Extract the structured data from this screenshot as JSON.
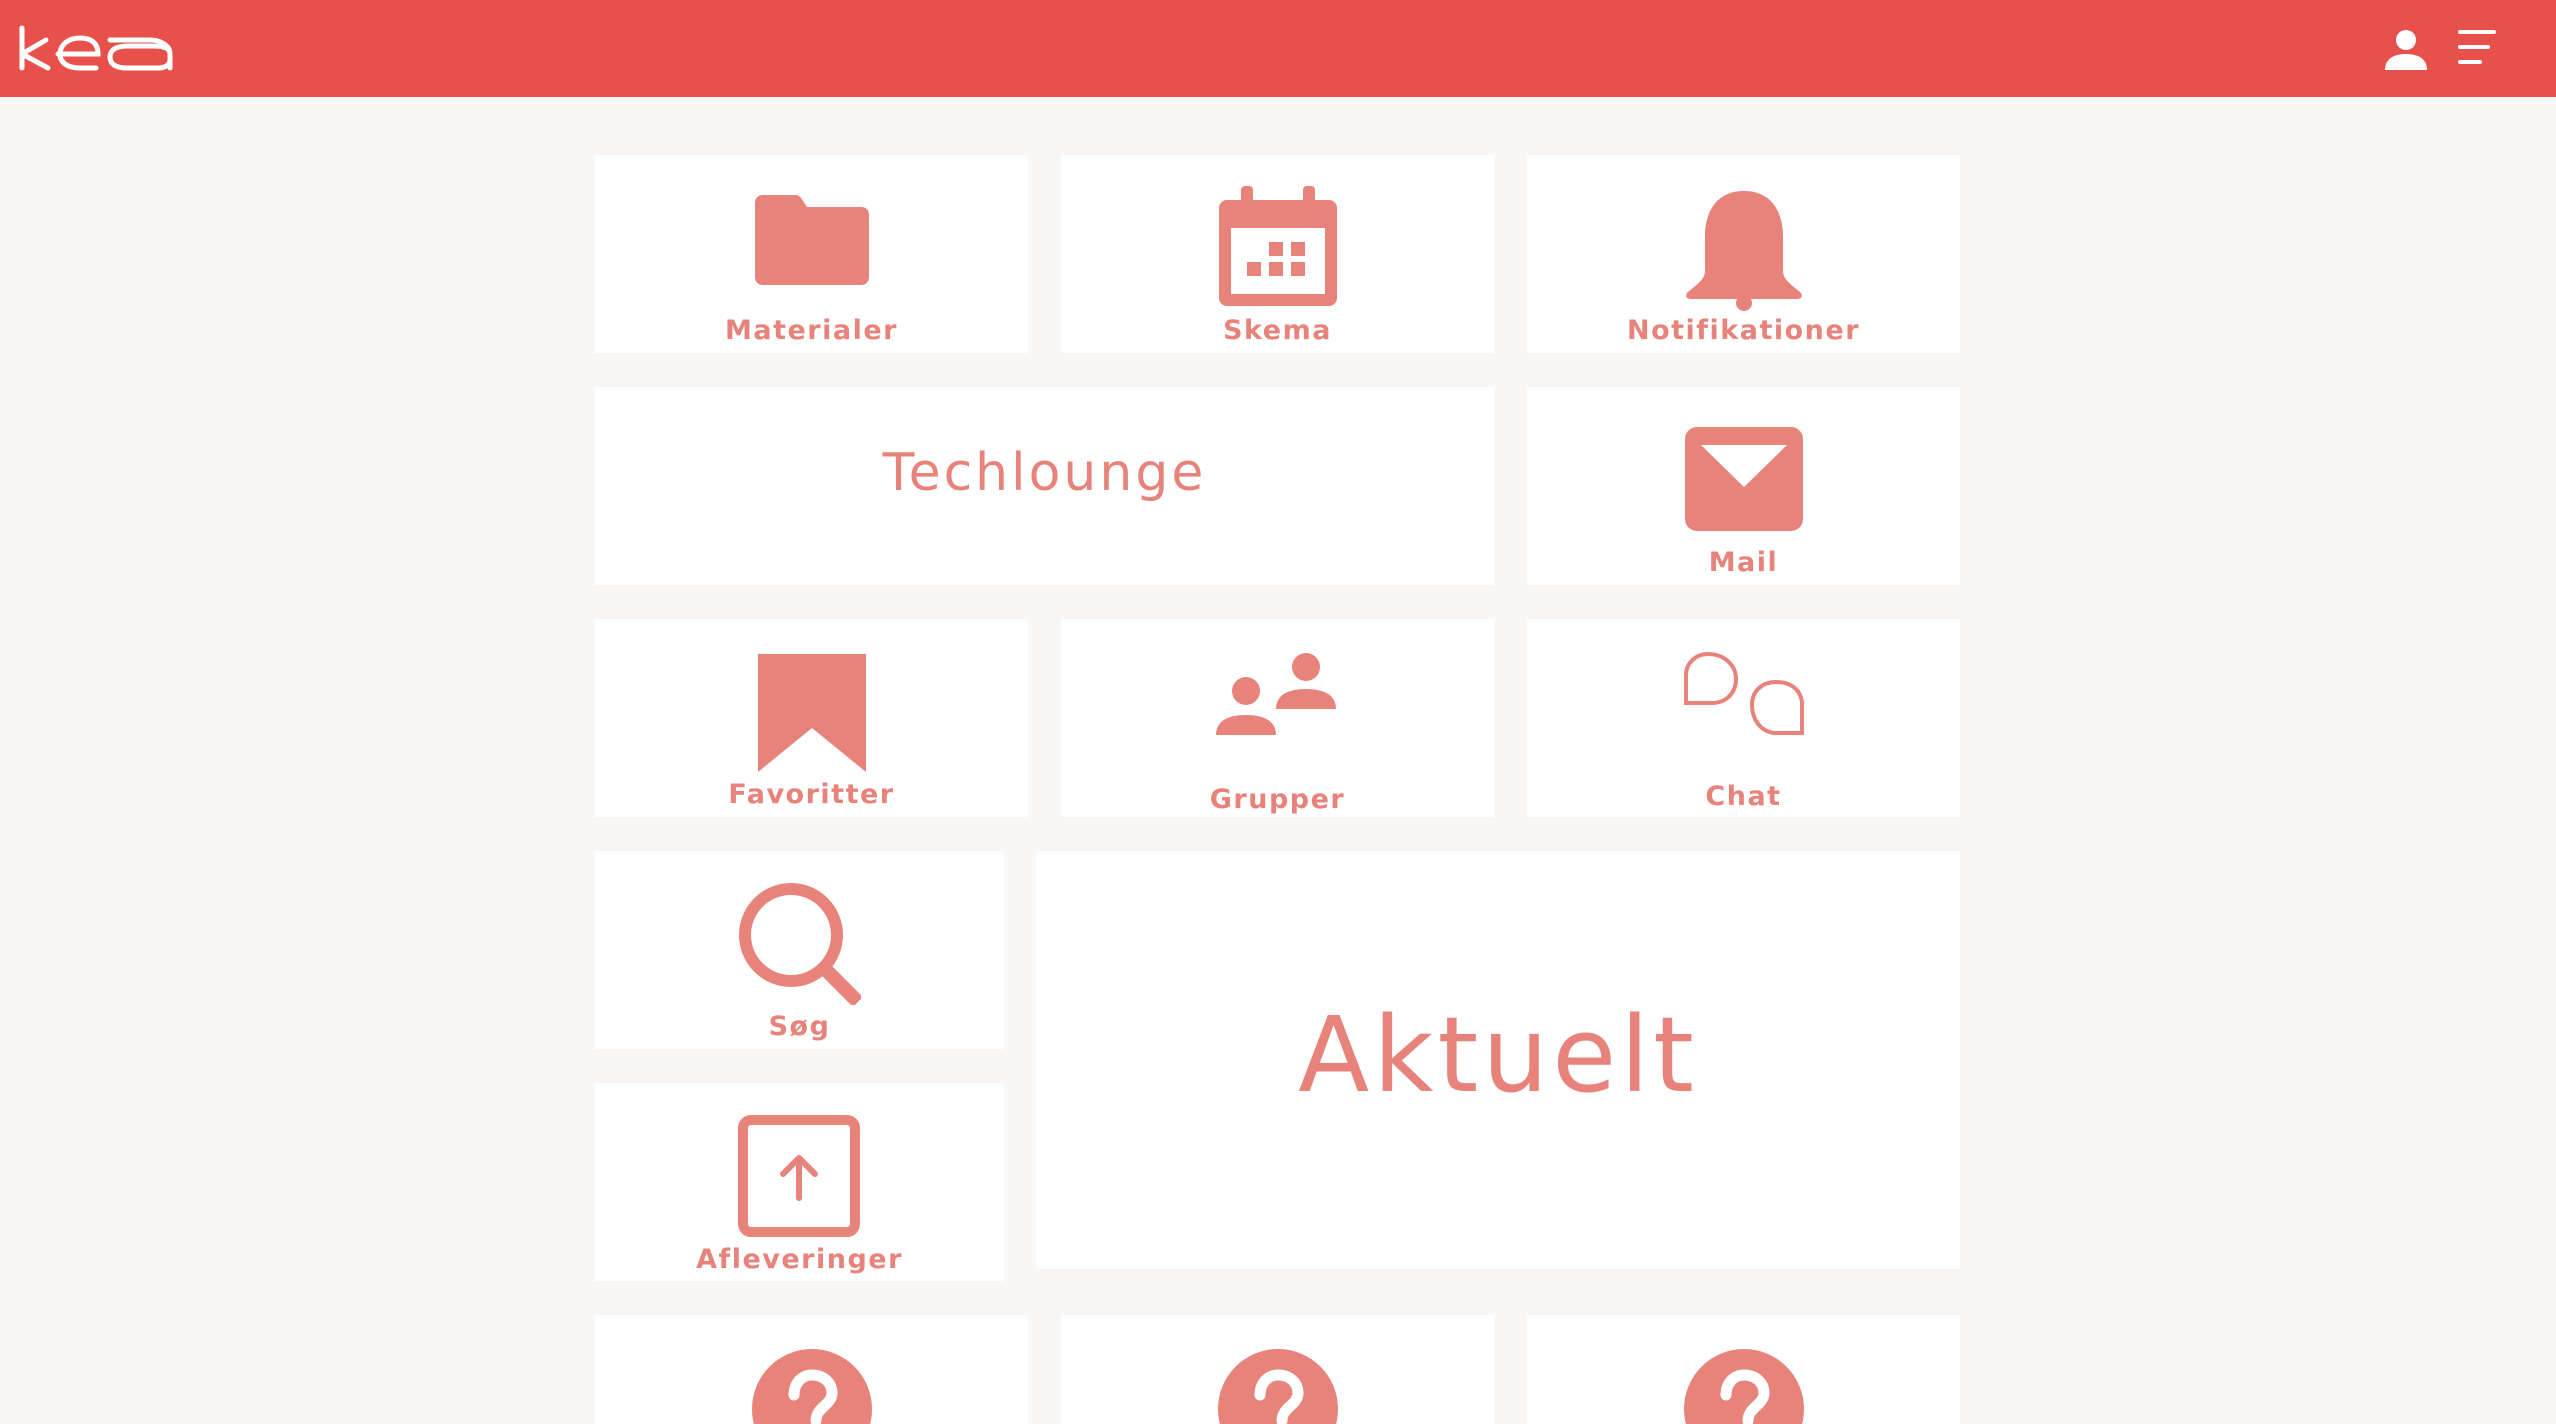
{
  "header": {
    "logo_text": "kea",
    "profile_icon": "user-icon",
    "menu_icon": "hamburger-menu-icon"
  },
  "colors": {
    "brand": "#e8514b",
    "tile_accent": "#e8837c",
    "background": "#f8f7f6",
    "tile_background": "#ffffff"
  },
  "tiles": {
    "materialer": {
      "label": "Materialer",
      "icon": "folder-icon"
    },
    "skema": {
      "label": "Skema",
      "icon": "calendar-icon"
    },
    "notifikationer": {
      "label": "Notifikationer",
      "icon": "bell-icon"
    },
    "techlounge": {
      "label": "Techlounge"
    },
    "mail": {
      "label": "Mail",
      "icon": "envelope-icon"
    },
    "favoritter": {
      "label": "Favoritter",
      "icon": "bookmark-icon"
    },
    "grupper": {
      "label": "Grupper",
      "icon": "group-icon"
    },
    "chat": {
      "label": "Chat",
      "icon": "chat-bubbles-icon"
    },
    "soeg": {
      "label": "Søg",
      "icon": "search-icon"
    },
    "afleveringer": {
      "label": "Afleveringer",
      "icon": "upload-icon"
    },
    "aktuelt": {
      "label": "Aktuelt"
    },
    "unknown": {
      "icon": "question-mark-icon"
    }
  }
}
